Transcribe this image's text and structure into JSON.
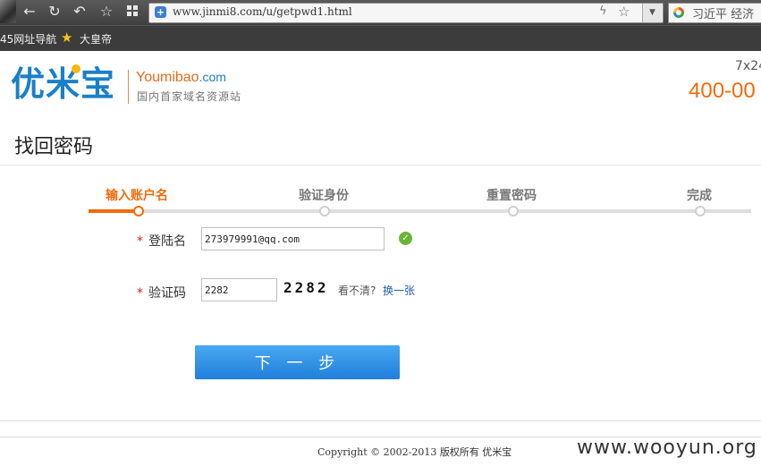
{
  "browser": {
    "url": "www.jinmi8.com/u/getpwd1.html",
    "search_text": "习近平 经济",
    "bookmarks": [
      "45网址导航",
      "大皇帝"
    ]
  },
  "header": {
    "logo_cn": "优米宝",
    "logo_en_main": "Youmibao",
    "logo_en_suffix": ".com",
    "logo_tagline": "国内首家域名资源站",
    "hotline_hours": "7x24",
    "hotline": "400-00"
  },
  "page": {
    "title": "找回密码"
  },
  "steps": [
    {
      "label": "输入账户名",
      "active": true
    },
    {
      "label": "验证身份",
      "active": false
    },
    {
      "label": "重置密码",
      "active": false
    },
    {
      "label": "完成",
      "active": false
    }
  ],
  "form": {
    "required_mark": "*",
    "username_label": "登陆名",
    "username_value": "273979991@qq.com",
    "captcha_label": "验证码",
    "captcha_value": "2282",
    "captcha_image_text": "2282",
    "captcha_hint": "看不清?",
    "captcha_refresh": "换一张",
    "next_button": "下 一 步"
  },
  "footer": {
    "copyright": "Copyright © 2002-2013 版权所有 优米宝",
    "watermark": "www.wooyun.org"
  },
  "colors": {
    "brand_blue": "#1a7fc8",
    "brand_orange": "#f26b0c",
    "button_blue": "#2b8de6"
  }
}
